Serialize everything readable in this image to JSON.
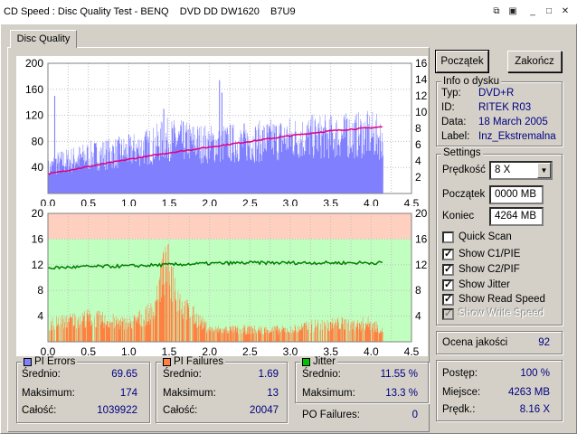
{
  "window": {
    "title": "CD Speed : Disc Quality Test - BENQ    DVD DD DW1620    B7U9",
    "icons": [
      "copy-icon",
      "save-icon",
      "minimize-icon",
      "maximize-icon",
      "close-icon"
    ]
  },
  "tab": {
    "label": "Disc Quality"
  },
  "buttons": {
    "start": "Początek",
    "stop": "Zakończ"
  },
  "disc_info": {
    "title": "Info o dysku",
    "rows": [
      {
        "label": "Typ:",
        "value": "DVD+R"
      },
      {
        "label": "ID:",
        "value": "RITEK R03"
      },
      {
        "label": "Data:",
        "value": "18 March 2005"
      },
      {
        "label": "Label:",
        "value": "Inz_Ekstremalna"
      }
    ]
  },
  "settings": {
    "title": "Settings",
    "speed_label": "Prędkość",
    "speed_value": "8 X",
    "start_label": "Początek",
    "start_value": "0000 MB",
    "end_label": "Koniec",
    "end_value": "4264 MB",
    "checkboxes": [
      {
        "label": "Quick Scan",
        "checked": false,
        "disabled": false
      },
      {
        "label": "Show C1/PIE",
        "checked": true,
        "disabled": false
      },
      {
        "label": "Show C2/PIF",
        "checked": true,
        "disabled": false
      },
      {
        "label": "Show Jitter",
        "checked": true,
        "disabled": false
      },
      {
        "label": "Show Read Speed",
        "checked": true,
        "disabled": false
      },
      {
        "label": "Show Write Speed",
        "checked": true,
        "disabled": true
      }
    ]
  },
  "quality": {
    "label": "Ocena jakości",
    "value": "92"
  },
  "progress": {
    "rows": [
      {
        "label": "Postęp:",
        "value": "100 %"
      },
      {
        "label": "Miejsce:",
        "value": "4263 MB"
      },
      {
        "label": "Prędk.:",
        "value": "8.16 X"
      }
    ]
  },
  "stats": {
    "pi_errors": {
      "title": "PI Errors",
      "color": "#8080ff",
      "rows": [
        {
          "label": "Średnio:",
          "value": "69.65"
        },
        {
          "label": "Maksimum:",
          "value": "174"
        },
        {
          "label": "Całość:",
          "value": "1039922"
        }
      ]
    },
    "pi_failures": {
      "title": "PI Failures",
      "color": "#ff8040",
      "rows": [
        {
          "label": "Średnio:",
          "value": "1.69"
        },
        {
          "label": "Maksimum:",
          "value": "13"
        },
        {
          "label": "Całość:",
          "value": "20047"
        }
      ]
    },
    "jitter": {
      "title": "Jitter",
      "color": "#00c000",
      "rows": [
        {
          "label": "Średnio:",
          "value": "11.55 %"
        },
        {
          "label": "Maksimum:",
          "value": "13.3 %"
        }
      ]
    },
    "po_failures": {
      "label": "PO Failures:",
      "value": "0"
    }
  },
  "chart_data": [
    {
      "type": "bar",
      "name": "pi-errors-chart",
      "x_ticks": [
        "0.0",
        "0.5",
        "1.0",
        "1.5",
        "2.0",
        "2.5",
        "3.0",
        "3.5",
        "4.0",
        "4.5"
      ],
      "y_left_ticks": [
        "200",
        "160",
        "120",
        "80",
        "40"
      ],
      "y_right_ticks": [
        "16",
        "14",
        "12",
        "10",
        "8",
        "6",
        "4",
        "2"
      ],
      "xlim": [
        0,
        4.5
      ],
      "ylim_left": [
        0,
        200
      ],
      "ylim_right": [
        0,
        16
      ],
      "pie_profile": [
        [
          0,
          40
        ],
        [
          0.1,
          50
        ],
        [
          0.5,
          62
        ],
        [
          1.0,
          70
        ],
        [
          1.3,
          80
        ],
        [
          1.45,
          90
        ],
        [
          2.0,
          82
        ],
        [
          2.5,
          85
        ],
        [
          3.0,
          92
        ],
        [
          3.5,
          95
        ],
        [
          4.0,
          98
        ],
        [
          4.15,
          90
        ]
      ],
      "pie_spikes": [
        [
          0.08,
          150
        ],
        [
          1.43,
          130
        ],
        [
          2.12,
          174
        ],
        [
          2.15,
          155
        ],
        [
          3.7,
          115
        ]
      ],
      "read_speed": [
        [
          0,
          2.4
        ],
        [
          0.5,
          3.3
        ],
        [
          1.0,
          4.2
        ],
        [
          1.5,
          5.0
        ],
        [
          2.0,
          5.7
        ],
        [
          2.5,
          6.4
        ],
        [
          3.0,
          7.1
        ],
        [
          3.5,
          7.7
        ],
        [
          4.15,
          8.2
        ]
      ]
    },
    {
      "type": "bar",
      "name": "pi-failures-chart",
      "x_ticks": [
        "0.0",
        "0.5",
        "1.0",
        "1.5",
        "2.0",
        "2.5",
        "3.0",
        "3.5",
        "4.0",
        "4.5"
      ],
      "y_left_ticks": [
        "20",
        "16",
        "12",
        "8",
        "4"
      ],
      "y_right_ticks": [
        "20",
        "16",
        "12",
        "8",
        "4"
      ],
      "xlim": [
        0,
        4.5
      ],
      "ylim": [
        0,
        20
      ],
      "pif_profile": [
        [
          0,
          3
        ],
        [
          0.5,
          4
        ],
        [
          1.0,
          3
        ],
        [
          1.3,
          5
        ],
        [
          1.4,
          11
        ],
        [
          1.5,
          12
        ],
        [
          1.65,
          6
        ],
        [
          2.0,
          2
        ],
        [
          2.5,
          2
        ],
        [
          3.0,
          2
        ],
        [
          3.4,
          3
        ],
        [
          4.0,
          3
        ],
        [
          4.15,
          2
        ]
      ],
      "jitter": [
        [
          0,
          11.5
        ],
        [
          0.5,
          11.7
        ],
        [
          1.0,
          11.8
        ],
        [
          1.5,
          12.0
        ],
        [
          2.0,
          12.2
        ],
        [
          2.5,
          12.3
        ],
        [
          3.0,
          12.3
        ],
        [
          3.5,
          12.3
        ],
        [
          4.15,
          12.3
        ]
      ]
    }
  ]
}
